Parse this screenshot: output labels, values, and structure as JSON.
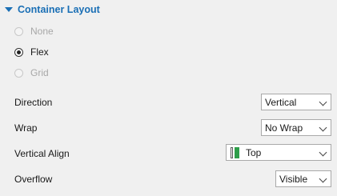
{
  "section": {
    "title": "Container Layout"
  },
  "layout_options": [
    {
      "label": "None",
      "state": "disabled"
    },
    {
      "label": "Flex",
      "state": "checked"
    },
    {
      "label": "Grid",
      "state": "disabled"
    }
  ],
  "properties": {
    "direction": {
      "label": "Direction",
      "value": "Vertical"
    },
    "wrap": {
      "label": "Wrap",
      "value": "No Wrap"
    },
    "vertical_align": {
      "label": "Vertical Align",
      "value": "Top",
      "icon": "align-top-icon"
    },
    "overflow": {
      "label": "Overflow",
      "value": "Visible"
    }
  },
  "colors": {
    "accent": "#1a6fb5",
    "icon_green": "#2e9e4a",
    "background": "#f0f0f0"
  }
}
